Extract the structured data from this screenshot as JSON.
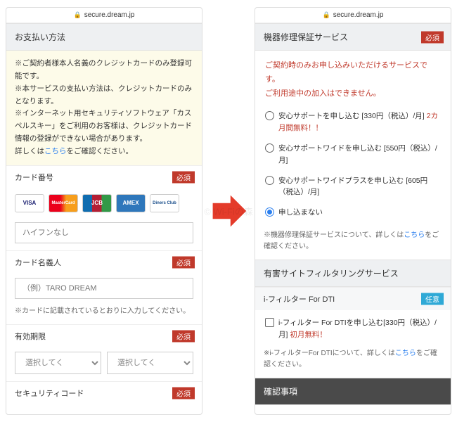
{
  "url": "secure.dream.jp",
  "watermark": "© Wi-Fiの森",
  "badges": {
    "required": "必須",
    "optional": "任意"
  },
  "left": {
    "paymentHeader": "お支払い方法",
    "notice": {
      "l1": "※ご契約者様本人名義のクレジットカードのみ登録可能です。",
      "l2": "※本サービスの支払い方法は、クレジットカードのみとなります。",
      "l3a": "※インターネット用セキュリティソフトウェア「カスペルスキー」をご利用のお客様は、クレジットカード情報の登録ができない場合があります。",
      "l3b": "詳しくは",
      "l3link": "こちら",
      "l3c": "をご確認ください。"
    },
    "cardNumber": {
      "label": "カード番号",
      "placeholder": "ハイフンなし"
    },
    "cards": {
      "visa": "VISA",
      "mc": "MasterCard",
      "jcb": "JCB",
      "amex": "AMEX",
      "diners": "Diners Club"
    },
    "cardHolder": {
      "label": "カード名義人",
      "placeholder": "（例）TARO DREAM",
      "hint": "※カードに記載されているとおりに入力してください。"
    },
    "expiry": {
      "label": "有効期限",
      "select": "選択してく"
    },
    "cvv": {
      "label": "セキュリティコード"
    }
  },
  "right": {
    "repairHeader": "機器修理保証サービス",
    "warning": {
      "l1": "ご契約時のみお申し込みいただけるサービスです。",
      "l2": "ご利用途中の加入はできません。"
    },
    "options": {
      "o1a": "安心サポートを申し込む [330円（税込）/月]  ",
      "o1b": "2カ月間無料！！",
      "o2": "安心サポートワイドを申し込む [550円（税込）/月]",
      "o3": "安心サポートワイドプラスを申し込む [605円（税込）/月]",
      "o4": "申し込まない"
    },
    "repairNote": {
      "a": "※機器修理保証サービスについて、詳しくは",
      "link": "こちら",
      "b": "をご確認ください。"
    },
    "filterHeader": "有害サイトフィルタリングサービス",
    "filterProduct": "i-フィルター For DTI",
    "filterCheck": {
      "a": "i-フィルター For DTIを申し込む[330円（税込）/月]  ",
      "b": "初月無料！"
    },
    "filterNote": {
      "a": "※i-フィルターFor DTIについて、詳しくは",
      "link": "こちら",
      "b": "をご確認ください。"
    },
    "confirmHeader": "確認事項"
  }
}
